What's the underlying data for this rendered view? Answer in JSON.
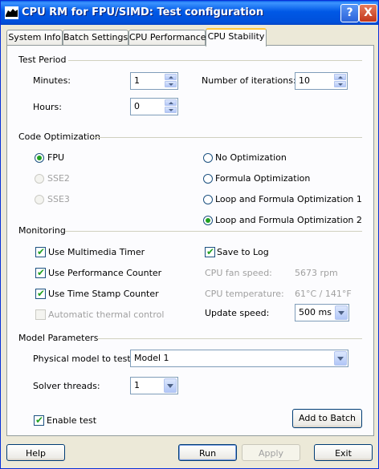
{
  "window": {
    "title": "CPU RM for FPU/SIMD: Test configuration",
    "help_icon": "?",
    "close_icon": "X"
  },
  "tabs": [
    "System Info",
    "Batch Settings",
    "CPU Performance",
    "CPU Stability"
  ],
  "active_tab": "CPU Stability",
  "test_period": {
    "title": "Test Period",
    "minutes_label": "Minutes:",
    "minutes_value": "1",
    "hours_label": "Hours:",
    "hours_value": "0",
    "iterations_label": "Number of iterations:",
    "iterations_value": "10"
  },
  "code_optimization": {
    "title": "Code Optimization",
    "fpu": "FPU",
    "sse2": "SSE2",
    "sse3": "SSE3",
    "no_opt": "No Optimization",
    "formula_opt": "Formula Optimization",
    "loop_formula_1": "Loop and Formula Optimization 1",
    "loop_formula_2": "Loop and Formula Optimization 2",
    "selected_instruction_set": "FPU",
    "selected_optimization": "Loop and Formula Optimization 2"
  },
  "monitoring": {
    "title": "Monitoring",
    "multimedia_timer": "Use Multimedia Timer",
    "performance_counter": "Use Performance Counter",
    "time_stamp_counter": "Use Time Stamp Counter",
    "thermal_control": "Automatic thermal control",
    "save_to_log": "Save to Log",
    "fan_speed_label": "CPU fan speed:",
    "fan_speed_value": "5673 rpm",
    "temperature_label": "CPU temperature:",
    "temperature_value": "61°C / 141°F",
    "update_speed_label": "Update speed:",
    "update_speed_value": "500 ms"
  },
  "model_parameters": {
    "title": "Model Parameters",
    "physical_model_label": "Physical model to test:",
    "physical_model_value": "Model 1",
    "solver_threads_label": "Solver threads:",
    "solver_threads_value": "1",
    "enable_test": "Enable test",
    "add_to_batch": "Add to Batch"
  },
  "buttons": {
    "help": "Help",
    "run": "Run",
    "apply": "Apply",
    "exit": "Exit"
  },
  "colors": {
    "titlebar": "#0058E6",
    "face": "#ECE9D8",
    "check": "#21A121",
    "tab_highlight": "#FFC83C"
  }
}
